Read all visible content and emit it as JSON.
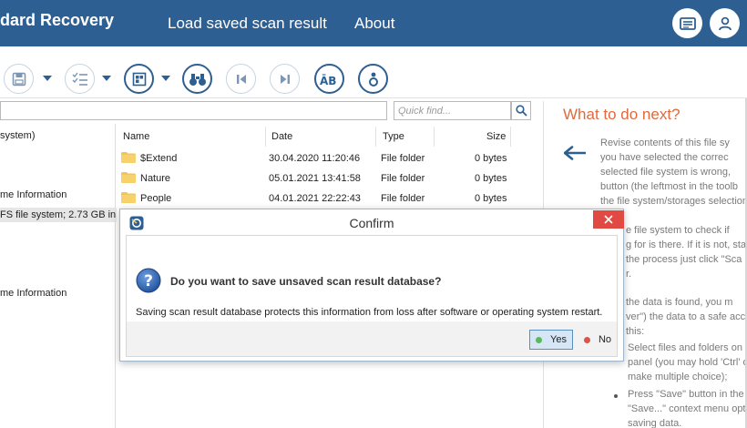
{
  "header": {
    "app_title": "dard Recovery",
    "nav": [
      "Load saved scan result",
      "About"
    ]
  },
  "find": {
    "placeholder": "Quick find..."
  },
  "tree": {
    "items": [
      "system)",
      "me Information",
      "FS file system; 2.73 GB in",
      "me Information"
    ]
  },
  "file_list": {
    "columns": [
      "Name",
      "Date",
      "Type",
      "Size"
    ],
    "rows": [
      {
        "name": "$Extend",
        "date": "30.04.2020 11:20:46",
        "type": "File folder",
        "size": "0 bytes"
      },
      {
        "name": "Nature",
        "date": "05.01.2021 13:41:58",
        "type": "File folder",
        "size": "0 bytes"
      },
      {
        "name": "People",
        "date": "04.01.2021 22:22:43",
        "type": "File folder",
        "size": "0 bytes"
      }
    ]
  },
  "help": {
    "title": "What to do next?",
    "lines": [
      "Revise contents of this file sy",
      "you have selected the correc",
      "selected file system is wrong,",
      "button (the leftmost in the toolb",
      "the file system/storages selection",
      "e file system to check if",
      "g for is there. If it is not, sta",
      "the process just click \"Sca",
      "r.",
      "the data is found, you m",
      "ver\") the data to a safe acc",
      "this:",
      "Select files and folders on th",
      "panel (you may hold 'Ctrl' o",
      "make multiple choice);",
      "Press \"Save\" button in the",
      "\"Save...\" context menu opt",
      "saving data."
    ]
  },
  "dialog": {
    "title": "Confirm",
    "question": "Do you want to save unsaved scan result database?",
    "detail": "Saving scan result database protects this information from loss after software or operating system restart.",
    "yes_label": "Yes",
    "no_label": "No"
  },
  "colors": {
    "header_bg": "#2e5f92",
    "accent_orange": "#e06a3f",
    "close_red": "#e04a43",
    "yes_green": "#5cb85c",
    "no_red": "#d9534f"
  }
}
